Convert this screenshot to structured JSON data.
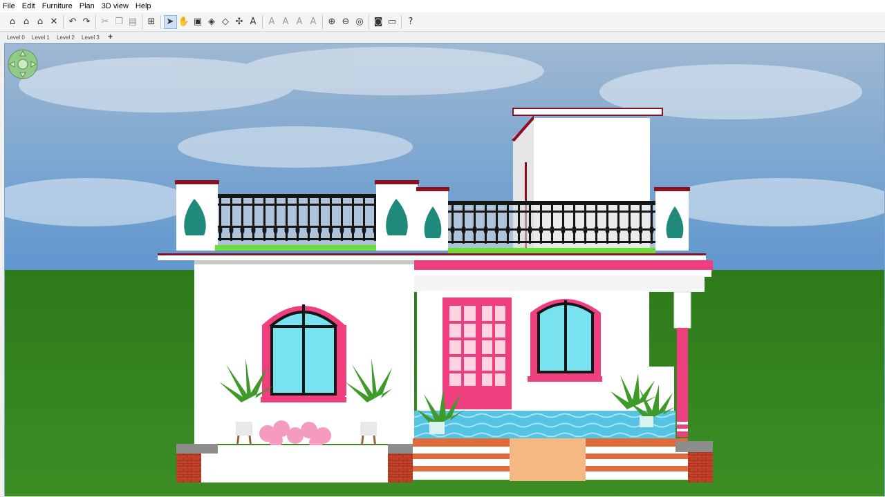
{
  "menu": [
    "File",
    "Edit",
    "Furniture",
    "Plan",
    "3D view",
    "Help"
  ],
  "toolbar": [
    {
      "name": "new-home-icon",
      "glyph": "⌂",
      "state": "normal"
    },
    {
      "name": "open-icon",
      "glyph": "⌂",
      "state": "normal"
    },
    {
      "name": "save-icon",
      "glyph": "⌂",
      "state": "normal"
    },
    {
      "name": "cut-tools-icon",
      "glyph": "✕",
      "state": "normal"
    },
    {
      "sep": true
    },
    {
      "name": "undo-icon",
      "glyph": "↶",
      "state": "normal"
    },
    {
      "name": "redo-icon",
      "glyph": "↷",
      "state": "normal"
    },
    {
      "sep": true
    },
    {
      "name": "cut-icon",
      "glyph": "✂",
      "state": "dim"
    },
    {
      "name": "copy-icon",
      "glyph": "❐",
      "state": "dim"
    },
    {
      "name": "paste-icon",
      "glyph": "▤",
      "state": "dim"
    },
    {
      "sep": true
    },
    {
      "name": "add-furniture-icon",
      "glyph": "⊞",
      "state": "normal"
    },
    {
      "sep": true
    },
    {
      "name": "select-mode-icon",
      "glyph": "➤",
      "state": "selected"
    },
    {
      "name": "pan-mode-icon",
      "glyph": "✋",
      "state": "normal"
    },
    {
      "name": "create-walls-icon",
      "glyph": "▣",
      "state": "normal"
    },
    {
      "name": "create-rooms-icon",
      "glyph": "◈",
      "state": "normal"
    },
    {
      "name": "create-polylines-icon",
      "glyph": "◇",
      "state": "normal"
    },
    {
      "name": "create-dimensions-icon",
      "glyph": "✣",
      "state": "normal"
    },
    {
      "name": "add-text-icon",
      "glyph": "A",
      "state": "normal"
    },
    {
      "sep": true
    },
    {
      "name": "increase-text-icon",
      "glyph": "A",
      "state": "dim"
    },
    {
      "name": "decrease-text-icon",
      "glyph": "A",
      "state": "dim"
    },
    {
      "name": "bold-text-icon",
      "glyph": "A",
      "state": "dim"
    },
    {
      "name": "italic-text-icon",
      "glyph": "A",
      "state": "dim"
    },
    {
      "sep": true
    },
    {
      "name": "zoom-in-icon",
      "glyph": "⊕",
      "state": "normal"
    },
    {
      "name": "zoom-out-icon",
      "glyph": "⊖",
      "state": "normal"
    },
    {
      "name": "aerial-view-icon",
      "glyph": "◎",
      "state": "normal"
    },
    {
      "sep": true
    },
    {
      "name": "create-photo-icon",
      "glyph": "◙",
      "state": "normal"
    },
    {
      "name": "create-video-icon",
      "glyph": "▭",
      "state": "normal"
    },
    {
      "sep": true
    },
    {
      "name": "help-icon",
      "glyph": "?",
      "state": "normal"
    }
  ],
  "levels": [
    "Level 0",
    "Level 1",
    "Level 2",
    "Level 3"
  ],
  "level_add": "+",
  "colors": {
    "wall_white": "#ffffff",
    "trim_pink": "#ef3f7f",
    "trim_dark_red": "#8a1020",
    "railing_black": "#161616",
    "grass": "#2f7d1c",
    "sky": "#7aa6d1",
    "glass": "#78e2ee",
    "pool_blue": "#5ec7e6",
    "brick": "#c8432a",
    "ornament_teal": "#1f8a7c"
  }
}
